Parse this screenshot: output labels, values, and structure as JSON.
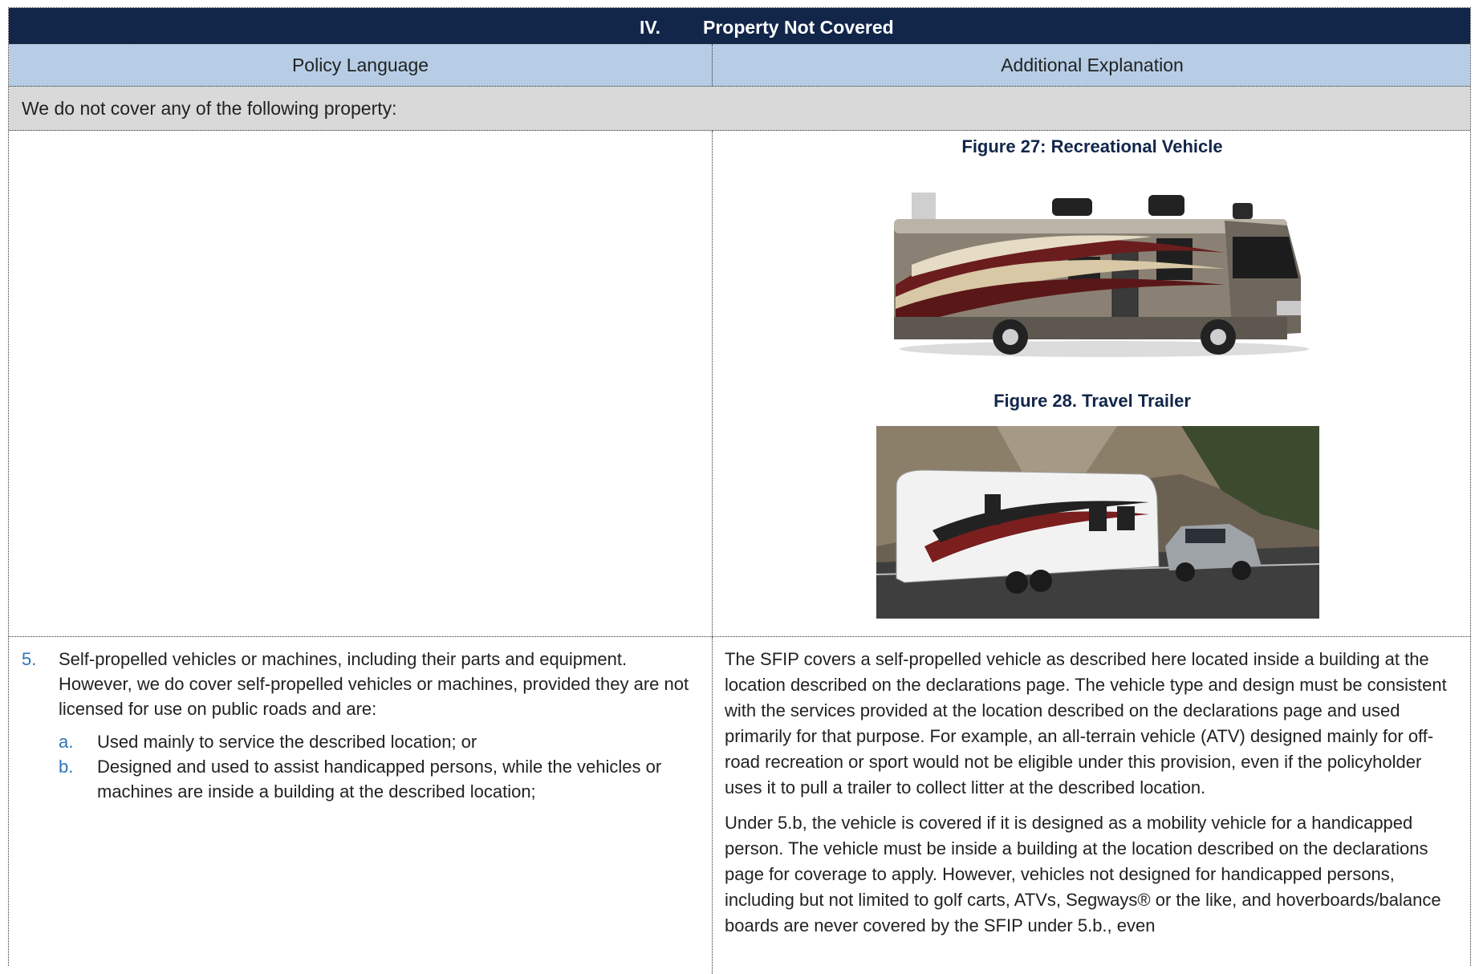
{
  "section": {
    "number": "IV.",
    "title": "Property Not Covered"
  },
  "headers": {
    "left": "Policy Language",
    "right": "Additional Explanation"
  },
  "intro": "We do not cover any of the following property:",
  "figures": [
    {
      "caption": "Figure 27: Recreational Vehicle",
      "image": "recreational-vehicle-photo"
    },
    {
      "caption": "Figure 28. Travel Trailer",
      "image": "travel-trailer-photo"
    }
  ],
  "policy": {
    "number": "5.",
    "text": "Self-propelled vehicles or machines, including their parts and equipment. However, we do cover self-propelled vehicles or machines, provided they are not licensed for use on public roads and are:",
    "subitems": [
      {
        "letter": "a.",
        "text": "Used mainly to service the described location; or"
      },
      {
        "letter": "b.",
        "text": "Designed and used to assist handicapped persons, while the vehicles or machines are inside a building at the described location;"
      }
    ]
  },
  "explanation": {
    "para1": "The SFIP covers a self-propelled vehicle as described here located inside a building at the location described on the declarations page. The vehicle type and design must be consistent with the services provided at the location described on the declarations page and used primarily for that purpose. For example, an all-terrain vehicle (ATV) designed mainly for off-road recreation or sport would not be eligible under this provision, even if the policyholder uses it to pull a trailer to collect litter at the described location.",
    "para2": "Under 5.b, the vehicle is covered if it is designed as a mobility vehicle for a handicapped person. The vehicle must be inside a building at the location described on the declarations page for coverage to apply. However, vehicles not designed for handicapped persons, including but not limited to golf carts, ATVs, Segways® or the like, and hoverboards/balance boards are never covered by the SFIP under 5.b., even"
  },
  "colors": {
    "title_bg": "#12264a",
    "header_bg": "#b7cde6",
    "intro_bg": "#d9d9d9",
    "accent": "#2e75b6"
  }
}
